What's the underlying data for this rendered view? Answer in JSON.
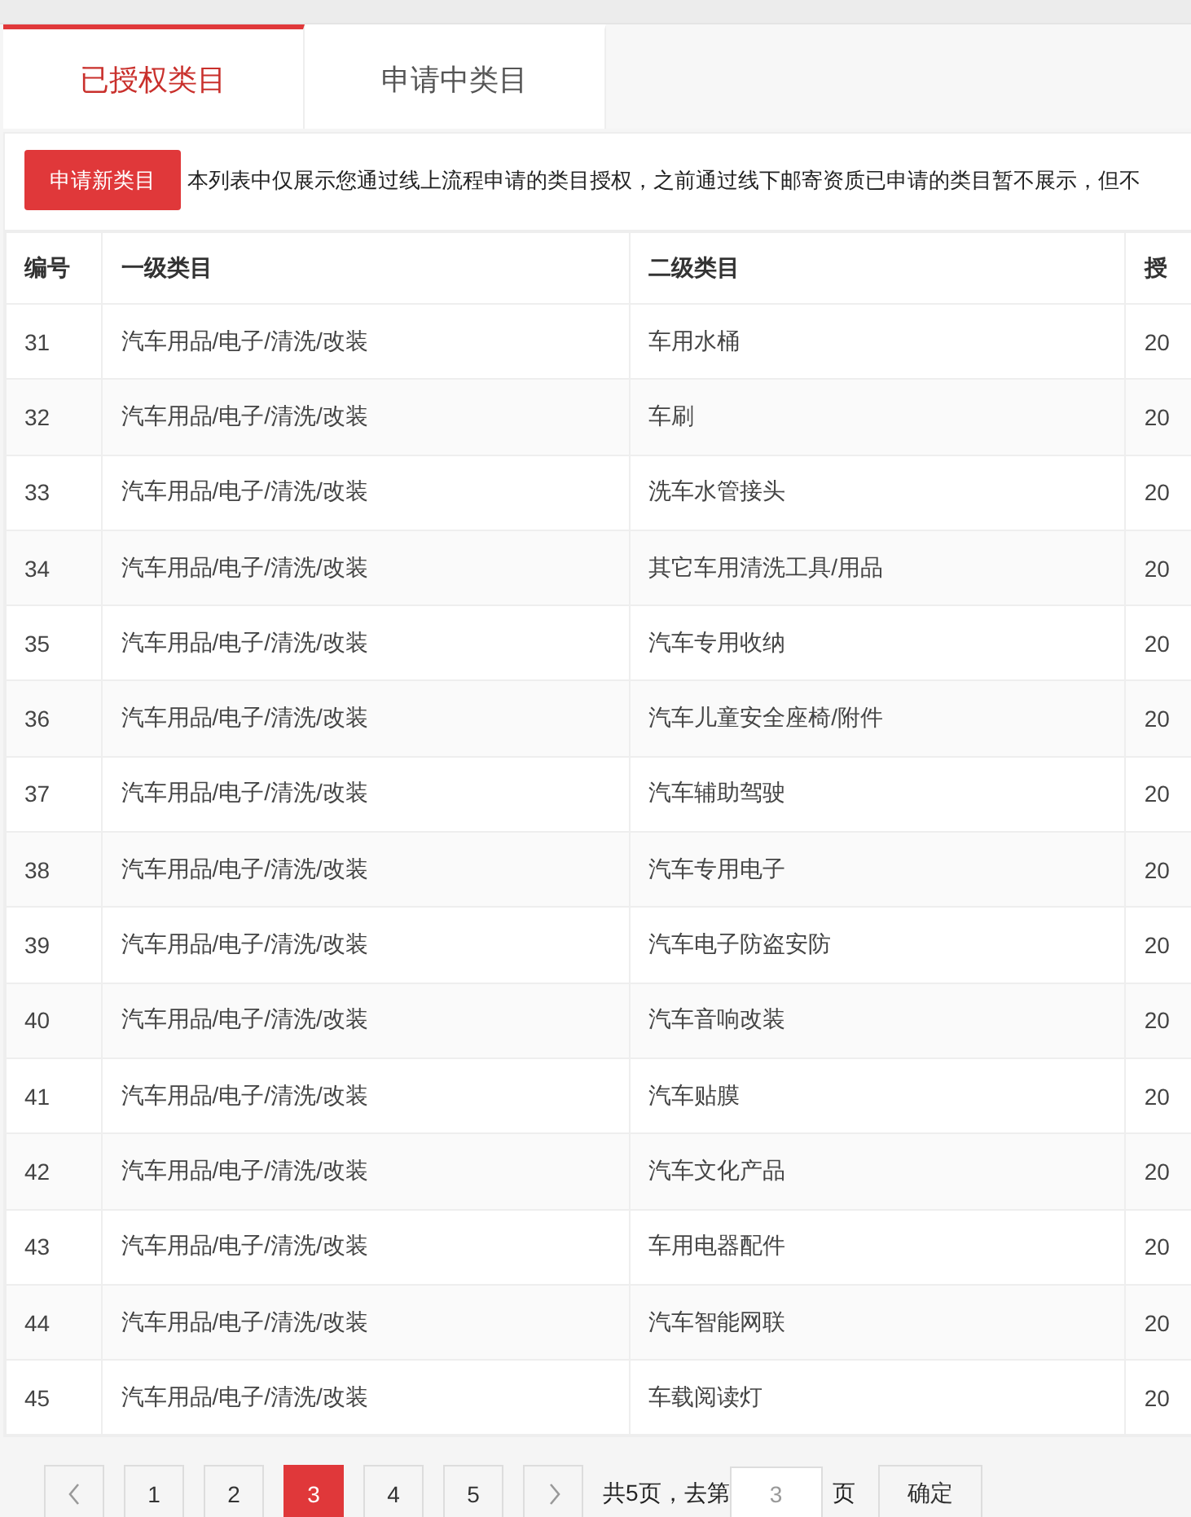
{
  "tabs": [
    {
      "label": "已授权类目",
      "selected": true
    },
    {
      "label": "申请中类目",
      "selected": false
    }
  ],
  "toolbar": {
    "button": "申请新类目",
    "notice": "本列表中仅展示您通过线上流程申请的类目授权，之前通过线下邮寄资质已申请的类目暂不展示，但不"
  },
  "table": {
    "columns": [
      "编号",
      "一级类目",
      "二级类目",
      "授"
    ],
    "rows": [
      [
        "31",
        "汽车用品/电子/清洗/改装",
        "车用水桶",
        "20"
      ],
      [
        "32",
        "汽车用品/电子/清洗/改装",
        "车刷",
        "20"
      ],
      [
        "33",
        "汽车用品/电子/清洗/改装",
        "洗车水管接头",
        "20"
      ],
      [
        "34",
        "汽车用品/电子/清洗/改装",
        "其它车用清洗工具/用品",
        "20"
      ],
      [
        "35",
        "汽车用品/电子/清洗/改装",
        "汽车专用收纳",
        "20"
      ],
      [
        "36",
        "汽车用品/电子/清洗/改装",
        "汽车儿童安全座椅/附件",
        "20"
      ],
      [
        "37",
        "汽车用品/电子/清洗/改装",
        "汽车辅助驾驶",
        "20"
      ],
      [
        "38",
        "汽车用品/电子/清洗/改装",
        "汽车专用电子",
        "20"
      ],
      [
        "39",
        "汽车用品/电子/清洗/改装",
        "汽车电子防盗安防",
        "20"
      ],
      [
        "40",
        "汽车用品/电子/清洗/改装",
        "汽车音响改装",
        "20"
      ],
      [
        "41",
        "汽车用品/电子/清洗/改装",
        "汽车贴膜",
        "20"
      ],
      [
        "42",
        "汽车用品/电子/清洗/改装",
        "汽车文化产品",
        "20"
      ],
      [
        "43",
        "汽车用品/电子/清洗/改装",
        "车用电器配件",
        "20"
      ],
      [
        "44",
        "汽车用品/电子/清洗/改装",
        "汽车智能网联",
        "20"
      ],
      [
        "45",
        "汽车用品/电子/清洗/改装",
        "车载阅读灯",
        "20"
      ]
    ]
  },
  "pagination": {
    "pages": [
      {
        "label": "1",
        "selected": false
      },
      {
        "label": "2",
        "selected": false
      },
      {
        "label": "3",
        "selected": true
      },
      {
        "label": "4",
        "selected": false
      },
      {
        "label": "5",
        "selected": false
      }
    ],
    "total_text": "共5页，去第",
    "jump_value": "3",
    "unit": "页",
    "confirm": "确定"
  }
}
